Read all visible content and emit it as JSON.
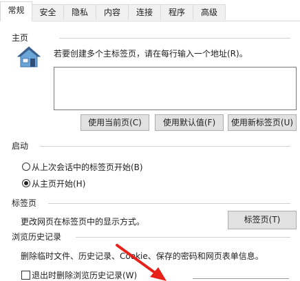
{
  "tabs": [
    {
      "label": "常规",
      "active": true
    },
    {
      "label": "安全",
      "active": false
    },
    {
      "label": "隐私",
      "active": false
    },
    {
      "label": "内容",
      "active": false
    },
    {
      "label": "连接",
      "active": false
    },
    {
      "label": "程序",
      "active": false
    },
    {
      "label": "高级",
      "active": false
    }
  ],
  "home": {
    "title": "主页",
    "description": "若要创建多个主标签页，请在每行输入一个地址(R)。",
    "icon": "house-icon",
    "buttons": {
      "use_current": "使用当前页(C)",
      "use_default": "使用默认值(F)",
      "use_new_tab": "使用新标签页(U)"
    }
  },
  "startup": {
    "title": "启动",
    "option_last_session": "从上次会话中的标签页开始(B)",
    "option_home": "从主页开始(H)",
    "selected": "home"
  },
  "tabs_section": {
    "title": "标签页",
    "description": "更改网页在标签页中的显示方式。",
    "button": "标签页(T)"
  },
  "history": {
    "title": "浏览历史记录",
    "description": "删除临时文件、历史记录、Cookie、保存的密码和网页表单信息。",
    "checkbox_label": "退出时删除浏览历史记录(W)",
    "checkbox_checked": false
  },
  "colors": {
    "annotation_arrow": "#e8201a"
  }
}
